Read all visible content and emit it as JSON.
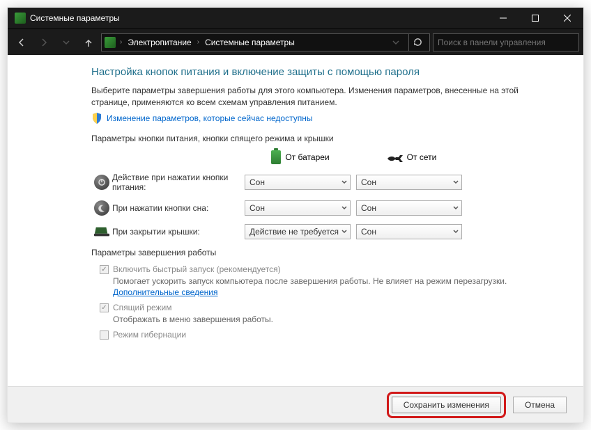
{
  "window": {
    "title": "Системные параметры"
  },
  "breadcrumb": {
    "item1": "Электропитание",
    "item2": "Системные параметры"
  },
  "search": {
    "placeholder": "Поиск в панели управления"
  },
  "heading": "Настройка кнопок питания и включение защиты с помощью пароля",
  "description": "Выберите параметры завершения работы для этого компьютера. Изменения параметров, внесенные на этой странице, применяются ко всем схемам управления питанием.",
  "unlock_link": "Изменение параметров, которые сейчас недоступны",
  "section1_label": "Параметры кнопки питания, кнопки спящего режима и крышки",
  "col_battery": "От батареи",
  "col_ac": "От сети",
  "rows": [
    {
      "label": "Действие при нажатии кнопки питания:",
      "battery": "Сон",
      "ac": "Сон"
    },
    {
      "label": "При нажатии кнопки сна:",
      "battery": "Сон",
      "ac": "Сон"
    },
    {
      "label": "При закрытии крышки:",
      "battery": "Действие не требуется",
      "ac": "Сон"
    }
  ],
  "section2_label": "Параметры завершения работы",
  "shutdown": {
    "fast_title": "Включить быстрый запуск (рекомендуется)",
    "fast_desc_1": "Помогает ускорить запуск компьютера после завершения работы. Не влияет на режим перезагрузки. ",
    "fast_desc_link": "Дополнительные сведения",
    "sleep_title": "Спящий режим",
    "sleep_desc": "Отображать в меню завершения работы.",
    "hiber_title": "Режим гибернации"
  },
  "buttons": {
    "save": "Сохранить изменения",
    "cancel": "Отмена"
  }
}
